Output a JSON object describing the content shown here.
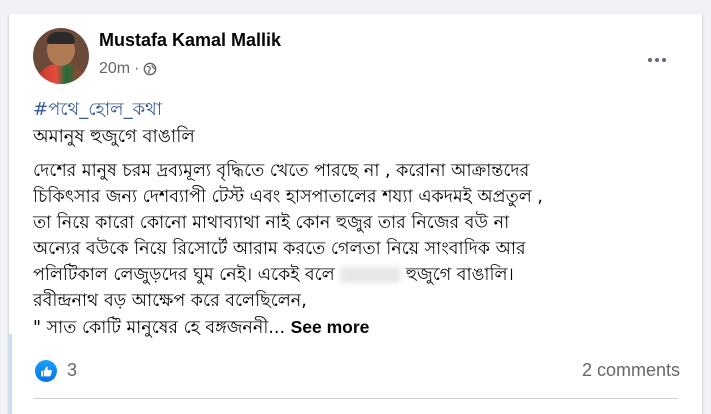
{
  "post": {
    "author": "Mustafa Kamal Mallik",
    "time": "20m",
    "dot": "·",
    "privacy_icon": "globe-icon",
    "hashtag": "#পথে_হোল_কথা",
    "title": "অমানুষ হুজুগে বাঙালি",
    "lines": [
      "দেশের মানুষ চরম দ্রব্যমূল্য বৃদ্ধিতে খেতে পারছে না , করোনা আক্রান্তদের",
      "চিকিৎসার জন্য দেশব্যাপী টেস্ট এবং হাসপাতালের শয্যা একদমই অপ্রতুল ,",
      "তা নিয়ে কারো কোনো মাথাব্যাথা নাই কোন হুজুর তার নিজের বউ না",
      "অন্যের বউকে নিয়ে রিসোর্টে আরাম করতে গেলতা নিয়ে সাংবাদিক আর",
      "পলিটিকাল লেজুড়দের ঘুম নেই। একেই বলে",
      "রবীন্দ্রনাথ বড় আক্ষেপ করে বলেছিলেন,",
      "\" সাত কোটি মানুষের হে বঙ্গজননী..."
    ],
    "line5_suffix": "হুজুগে বাঙালি।",
    "see_more": "See more"
  },
  "footer": {
    "like_icon": "thumbs-up-icon",
    "like_count": "3",
    "comments": "2 comments"
  },
  "colors": {
    "link": "#385898",
    "like": "#1877f2"
  }
}
